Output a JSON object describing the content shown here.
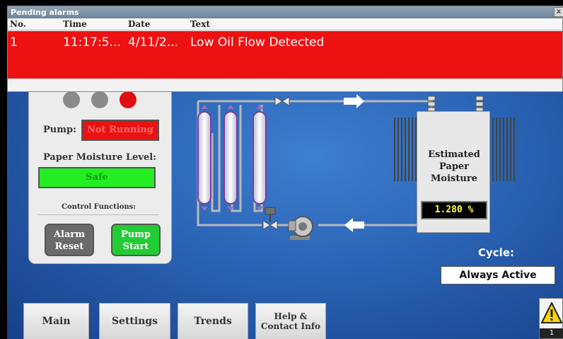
{
  "alarm_window": {
    "title": "Pending alarms",
    "close_glyph": "x",
    "columns": {
      "no": "No.",
      "time": "Time",
      "date": "Date",
      "text": "Text"
    },
    "rows": [
      {
        "no": "1",
        "time": "11:17:5...",
        "date": "4/11/2...",
        "text": "Low Oil Flow Detected"
      }
    ],
    "row_color": "#ee1111"
  },
  "control_panel": {
    "lamps": [
      {
        "state": "off",
        "color": "#8a8a8a"
      },
      {
        "state": "off",
        "color": "#8a8a8a"
      },
      {
        "state": "alarm",
        "color": "#e01010"
      }
    ],
    "pump_label": "Pump:",
    "pump_status": "Not Running",
    "moisture_label": "Paper Moisture Level:",
    "moisture_status": "Safe",
    "functions_label": "Control Functions:",
    "alarm_reset": {
      "line1": "Alarm",
      "line2": "Reset"
    },
    "pump_start": {
      "line1": "Pump",
      "line2": "Start"
    }
  },
  "dryer": {
    "label_line1": "Estimated",
    "label_line2": "Paper",
    "label_line3": "Moisture",
    "moisture_value": "1.280 %"
  },
  "cycle": {
    "label": "Cycle:",
    "value": "Always Active"
  },
  "nav": {
    "main": "Main",
    "settings": "Settings",
    "trends": "Trends",
    "help_line1": "Help &",
    "help_line2": "Contact Info"
  },
  "warning": {
    "icon": "warning-triangle-icon",
    "count": "1"
  }
}
